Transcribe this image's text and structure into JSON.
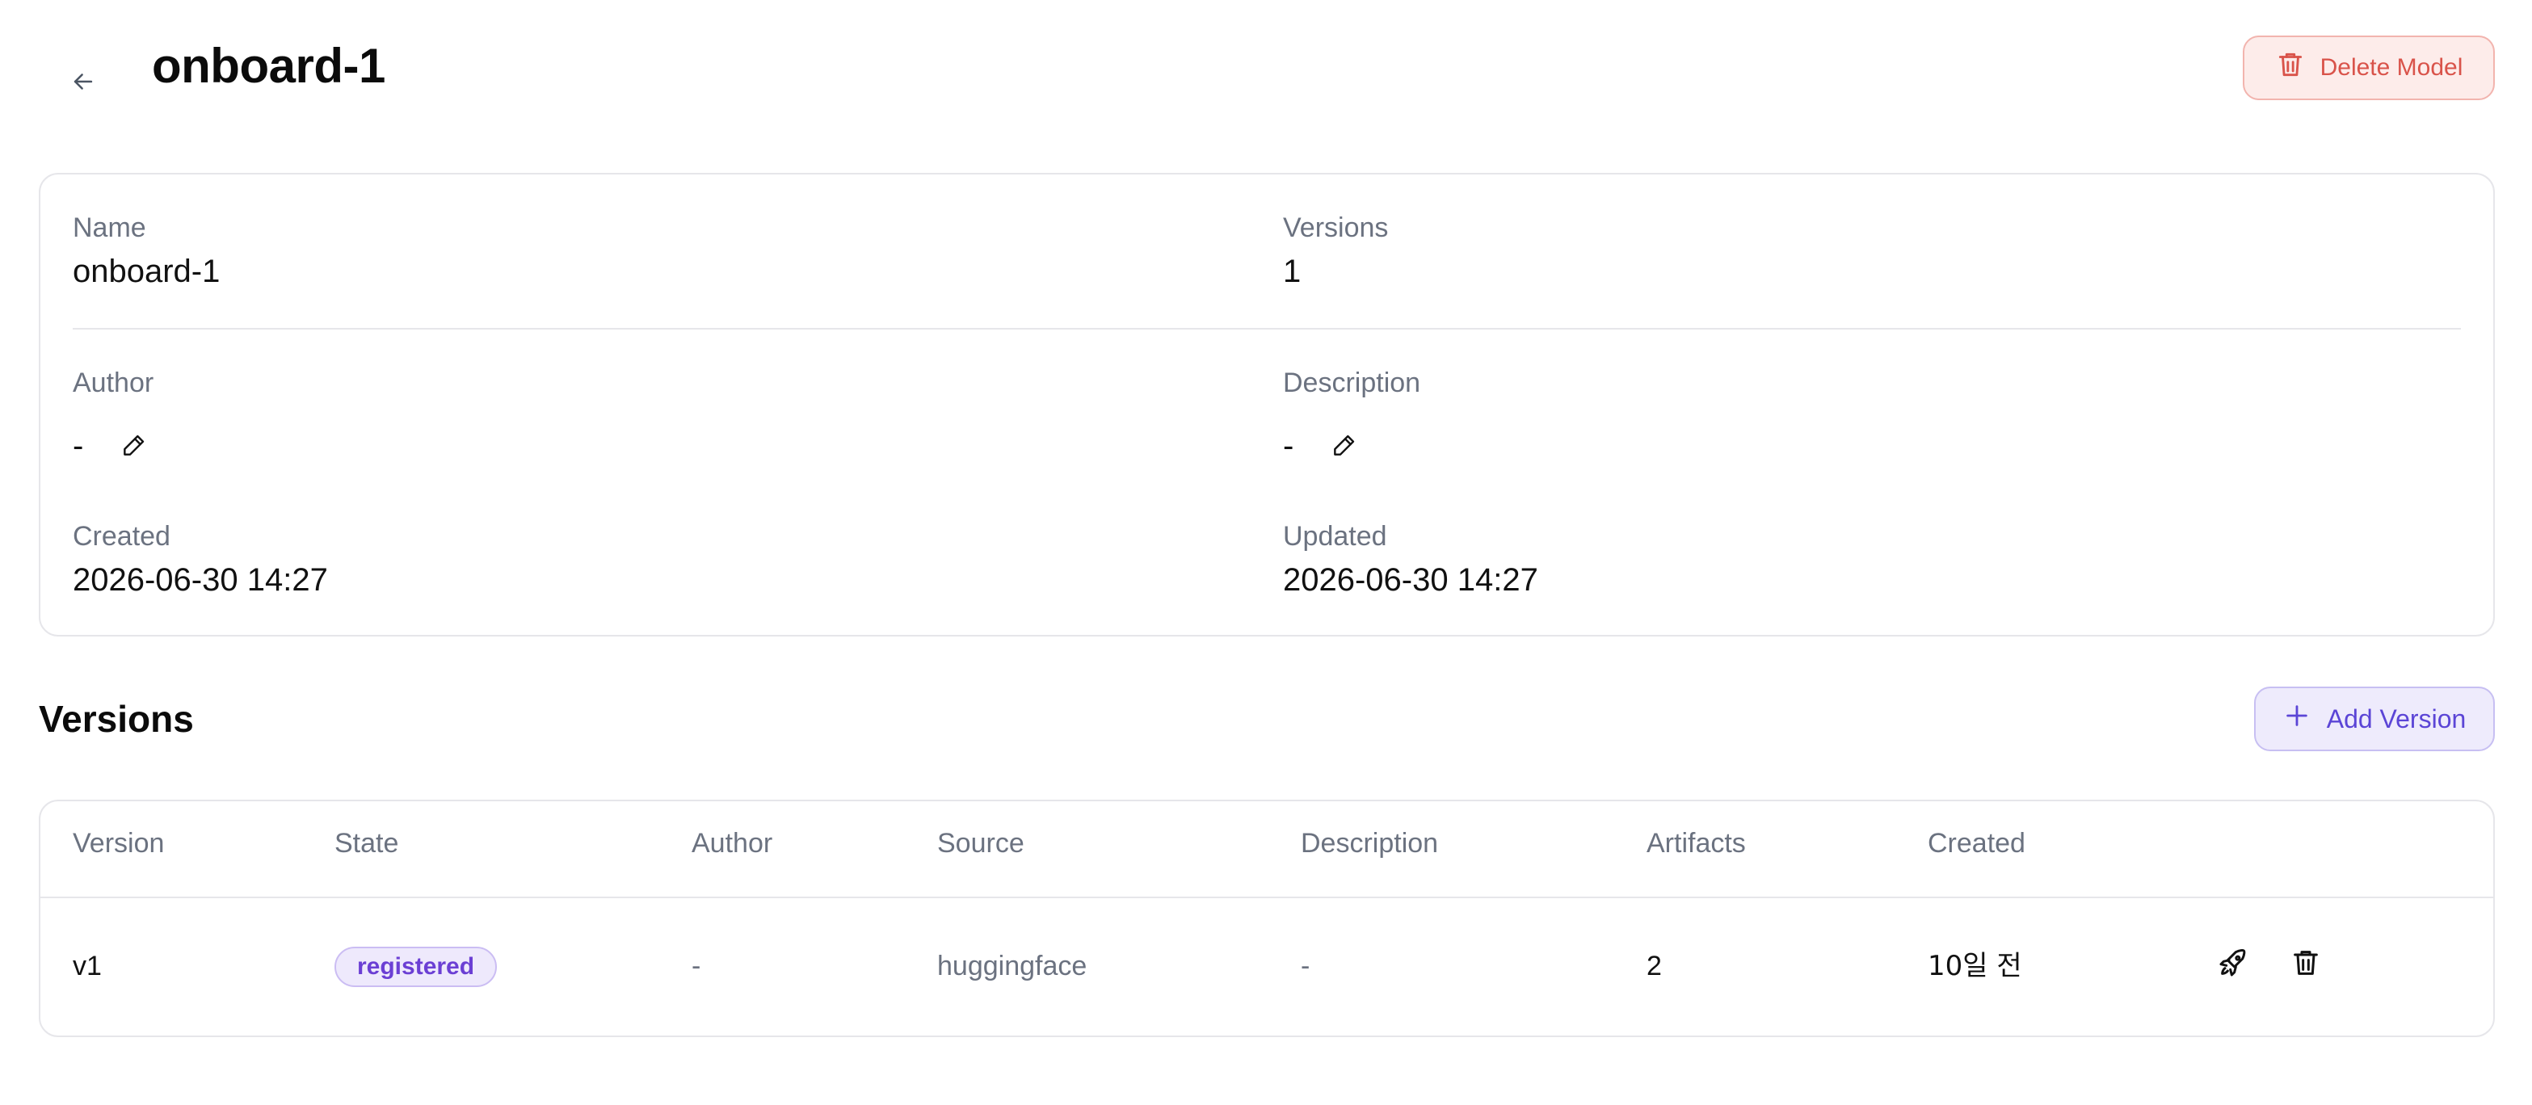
{
  "header": {
    "title": "onboard-1",
    "delete_label": "Delete Model"
  },
  "details": {
    "name": {
      "label": "Name",
      "value": "onboard-1"
    },
    "versions": {
      "label": "Versions",
      "value": "1"
    },
    "author": {
      "label": "Author",
      "value": "-"
    },
    "description": {
      "label": "Description",
      "value": "-"
    },
    "created": {
      "label": "Created",
      "value": "2026-06-30 14:27"
    },
    "updated": {
      "label": "Updated",
      "value": "2026-06-30 14:27"
    }
  },
  "versions_section": {
    "title": "Versions",
    "add_label": "Add Version"
  },
  "table": {
    "columns": [
      "Version",
      "State",
      "Author",
      "Source",
      "Description",
      "Artifacts",
      "Created"
    ],
    "rows": [
      {
        "version": "v1",
        "state": "registered",
        "author": "-",
        "source": "huggingface",
        "description": "-",
        "artifacts": "2",
        "created": "10일 전"
      }
    ]
  },
  "colors": {
    "danger": "#d9534a",
    "accent": "#5b45d6",
    "muted_text": "#6b7280",
    "border": "#e6e6ea"
  },
  "icons": {
    "back": "arrow-left-icon",
    "delete": "trash-icon",
    "edit": "pencil-icon",
    "add": "plus-icon",
    "deploy": "rocket-icon",
    "row_delete": "trash-icon"
  }
}
